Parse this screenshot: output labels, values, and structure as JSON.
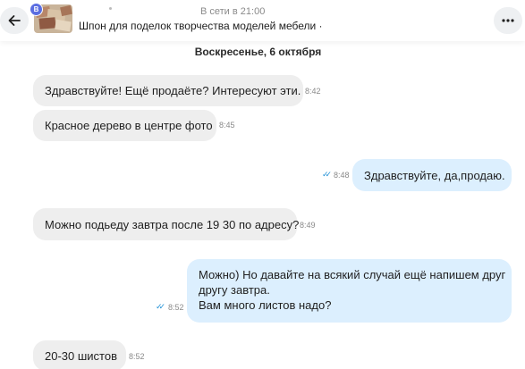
{
  "header": {
    "status": "В сети в 21:00",
    "title": "Шпон для поделок творчества моделей мебели",
    "title_suffix": " ·",
    "avatar_badge": "B",
    "back_icon": "arrow-left-icon",
    "more_icon": "more-horizontal-icon"
  },
  "chat": {
    "date": "Воскресенье, 6 октября",
    "messages": [
      {
        "dir": "in",
        "text": "Здравствуйте! Ещё продаёте? Интересуют эти.",
        "time": "8:42"
      },
      {
        "dir": "in",
        "text": "Красное дерево в центре фото",
        "time": "8:45"
      },
      {
        "dir": "out",
        "text": "Здравствуйте, да,продаю.",
        "time": "8:48",
        "read": true
      },
      {
        "dir": "in",
        "text": "Можно подьеду завтра после 19 30 по адресу?",
        "time": "8:49"
      },
      {
        "dir": "out",
        "lines": [
          "Можно) Но давайте на всякий случай ещё напишем друг",
          "другу завтра.",
          "Вам много листов надо?"
        ],
        "time": "8:52",
        "read": true
      },
      {
        "dir": "in",
        "text": "20-30 шистов",
        "time": "8:52"
      }
    ]
  },
  "colors": {
    "incoming_bubble": "#eeeeee",
    "outgoing_bubble": "#dceffe",
    "read_check": "#1d8fd6",
    "badge": "#5b6ee1"
  }
}
